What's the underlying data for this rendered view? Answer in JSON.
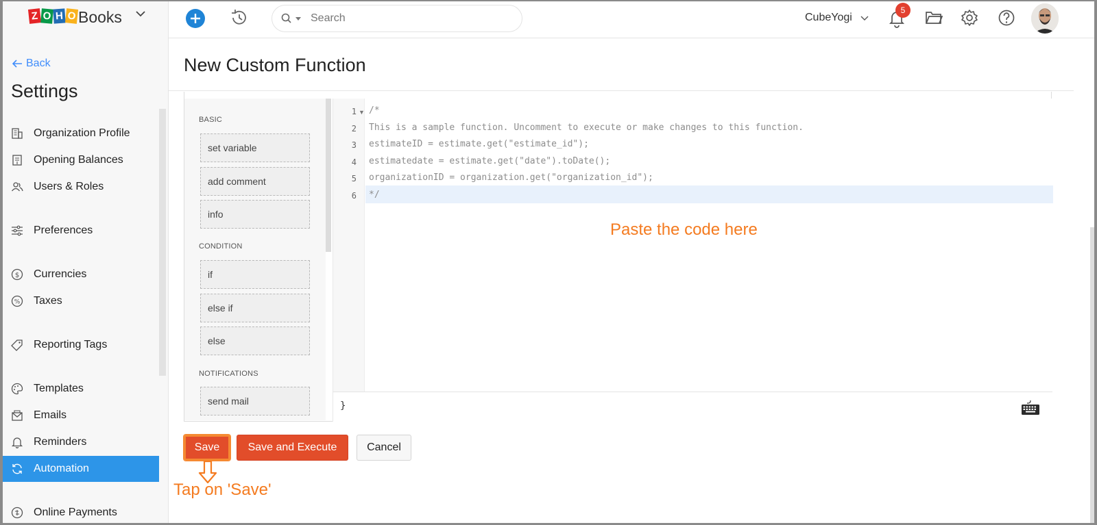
{
  "app": {
    "logo_letters": [
      "Z",
      "O",
      "H",
      "O"
    ],
    "logo_colors": [
      "#e42527",
      "#089949",
      "#226db4",
      "#f9b21d"
    ],
    "product": "Books"
  },
  "topbar": {
    "search_placeholder": "Search",
    "org_name": "CubeYogi",
    "notification_count": "5",
    "icons": [
      "plus-icon",
      "history-icon",
      "search-icon",
      "bell-icon",
      "folder-icon",
      "gear-icon",
      "help-icon"
    ]
  },
  "sidebar": {
    "back_label": "Back",
    "title": "Settings",
    "items": [
      {
        "label": "Organization Profile",
        "icon": "building-icon"
      },
      {
        "label": "Opening Balances",
        "icon": "ledger-icon"
      },
      {
        "label": "Users & Roles",
        "icon": "users-icon"
      },
      {
        "label": "Preferences",
        "icon": "sliders-icon"
      },
      {
        "label": "Currencies",
        "icon": "currency-icon"
      },
      {
        "label": "Taxes",
        "icon": "percent-icon"
      },
      {
        "label": "Reporting Tags",
        "icon": "tag-icon"
      },
      {
        "label": "Templates",
        "icon": "palette-icon"
      },
      {
        "label": "Emails",
        "icon": "envelope-icon"
      },
      {
        "label": "Reminders",
        "icon": "bell-icon"
      },
      {
        "label": "Automation",
        "icon": "refresh-icon",
        "active": true
      },
      {
        "label": "Online Payments",
        "icon": "payment-icon"
      }
    ]
  },
  "main": {
    "title": "New Custom Function",
    "palette": {
      "groups": [
        {
          "heading": "BASIC",
          "items": [
            "set variable",
            "add comment",
            "info"
          ]
        },
        {
          "heading": "CONDITION",
          "items": [
            "if",
            "else if",
            "else"
          ]
        },
        {
          "heading": "NOTIFICATIONS",
          "items": [
            "send mail"
          ]
        }
      ]
    },
    "editor": {
      "line_numbers": [
        "1",
        "2",
        "3",
        "4",
        "5",
        "6"
      ],
      "lines": [
        "/*",
        "This is a sample function. Uncomment to execute or make changes to this function.",
        "estimateID = estimate.get(\"estimate_id\");",
        "estimatedate = estimate.get(\"date\").toDate();",
        "organizationID = organization.get(\"organization_id\");",
        "*/"
      ],
      "closing_brace": "}"
    },
    "annotation_paste": "Paste the code here",
    "buttons": {
      "save": "Save",
      "save_execute": "Save and Execute",
      "cancel": "Cancel"
    },
    "annotation_tap": "Tap on 'Save'"
  },
  "colors": {
    "accent_blue": "#2d95e8",
    "primary_button": "#e24d2a",
    "annotation": "#f47b20",
    "badge": "#e2402f"
  }
}
